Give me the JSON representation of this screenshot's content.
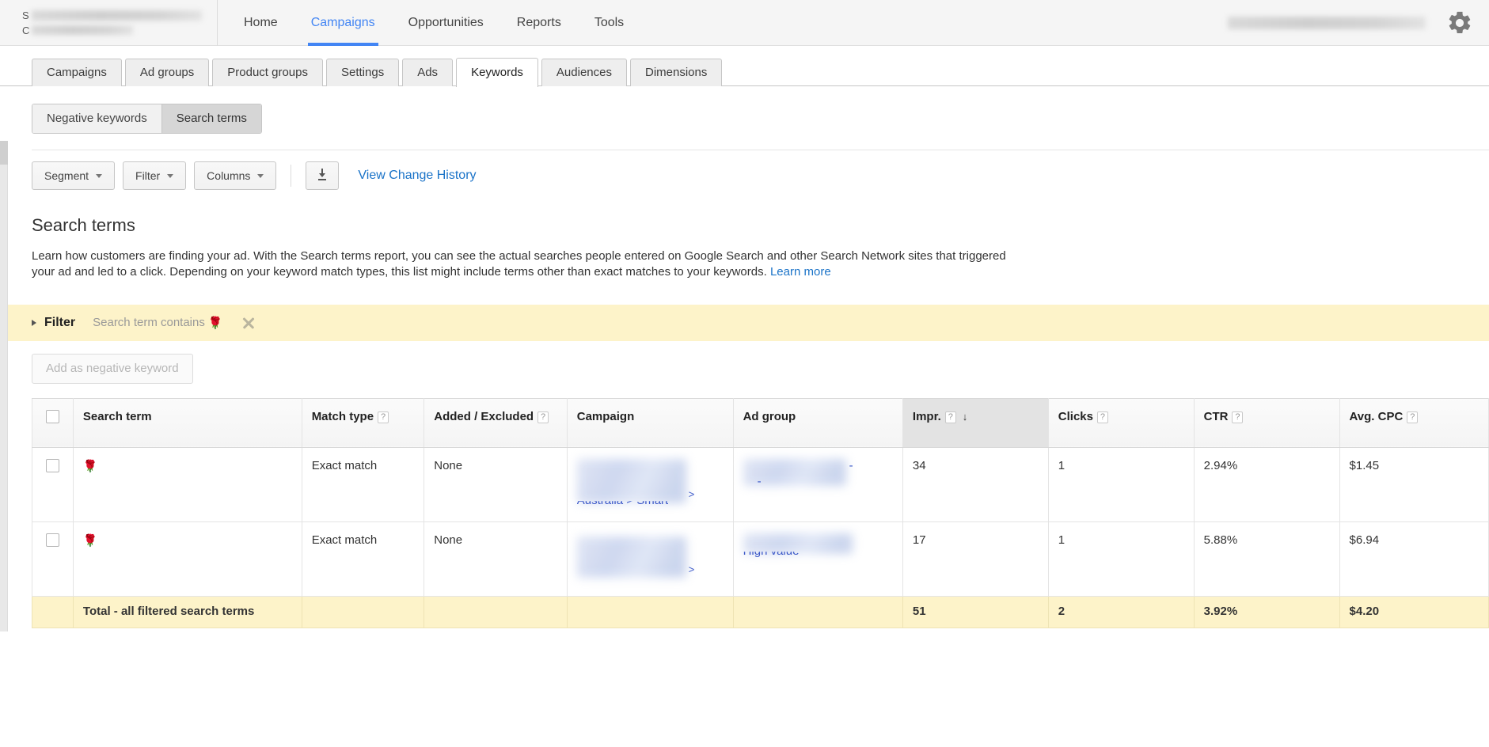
{
  "topbar": {
    "account_prefix_line1": "S",
    "account_prefix_line2": "C",
    "nav": [
      {
        "label": "Home",
        "active": false
      },
      {
        "label": "Campaigns",
        "active": true
      },
      {
        "label": "Opportunities",
        "active": false
      },
      {
        "label": "Reports",
        "active": false
      },
      {
        "label": "Tools",
        "active": false
      }
    ],
    "settings_icon": "gear-icon"
  },
  "tabs": [
    {
      "label": "Campaigns",
      "active": false
    },
    {
      "label": "Ad groups",
      "active": false
    },
    {
      "label": "Product groups",
      "active": false
    },
    {
      "label": "Settings",
      "active": false
    },
    {
      "label": "Ads",
      "active": false
    },
    {
      "label": "Keywords",
      "active": true
    },
    {
      "label": "Audiences",
      "active": false
    },
    {
      "label": "Dimensions",
      "active": false
    }
  ],
  "subtabs": [
    {
      "label": "Negative keywords",
      "selected": false
    },
    {
      "label": "Search terms",
      "selected": true
    }
  ],
  "toolbar": {
    "segment_label": "Segment",
    "filter_label": "Filter",
    "columns_label": "Columns",
    "download_icon": "download-icon",
    "change_history_link": "View Change History"
  },
  "page": {
    "title": "Search terms",
    "description": "Learn how customers are finding your ad. With the Search terms report, you can see the actual searches people entered on Google Search and other Search Network sites that triggered your ad and led to a click. Depending on your keyword match types, this list might include terms other than exact matches to your keywords.",
    "learn_more": "Learn more"
  },
  "filter_bar": {
    "label": "Filter",
    "condition_prefix": "Search term contains",
    "condition_value": "🌹",
    "remove_icon": "close-icon"
  },
  "actions": {
    "add_negative_keyword": "Add as negative keyword"
  },
  "table": {
    "columns": [
      {
        "label": "Search term",
        "help": false,
        "align": "left"
      },
      {
        "label": "Match type",
        "help": true,
        "align": "left"
      },
      {
        "label": "Added / Excluded",
        "help": true,
        "align": "left"
      },
      {
        "label": "Campaign",
        "help": false,
        "align": "left"
      },
      {
        "label": "Ad group",
        "help": false,
        "align": "left"
      },
      {
        "label": "Impr.",
        "help": true,
        "align": "right",
        "sorted": true,
        "sort_dir": "↓"
      },
      {
        "label": "Clicks",
        "help": true,
        "align": "right"
      },
      {
        "label": "CTR",
        "help": true,
        "align": "right"
      },
      {
        "label": "Avg. CPC",
        "help": true,
        "align": "right"
      }
    ],
    "rows": [
      {
        "search_term": "🌹",
        "match_type": "Exact match",
        "added_excluded": "None",
        "campaign_partial": "Australia > Smart",
        "ad_group_partial": "-",
        "impressions": "34",
        "clicks": "1",
        "ctr": "2.94%",
        "avg_cpc": "$1.45"
      },
      {
        "search_term": "🌹",
        "match_type": "Exact match",
        "added_excluded": "None",
        "campaign_partial": "",
        "ad_group_partial": "High value",
        "impressions": "17",
        "clicks": "1",
        "ctr": "5.88%",
        "avg_cpc": "$6.94"
      }
    ],
    "totals": {
      "label": "Total - all filtered search terms",
      "impressions": "51",
      "clicks": "2",
      "ctr": "3.92%",
      "avg_cpc": "$4.20"
    }
  },
  "colors": {
    "accent_blue": "#4285f4",
    "link_blue": "#1a73c8",
    "highlight_yellow": "#fdf3c9"
  }
}
